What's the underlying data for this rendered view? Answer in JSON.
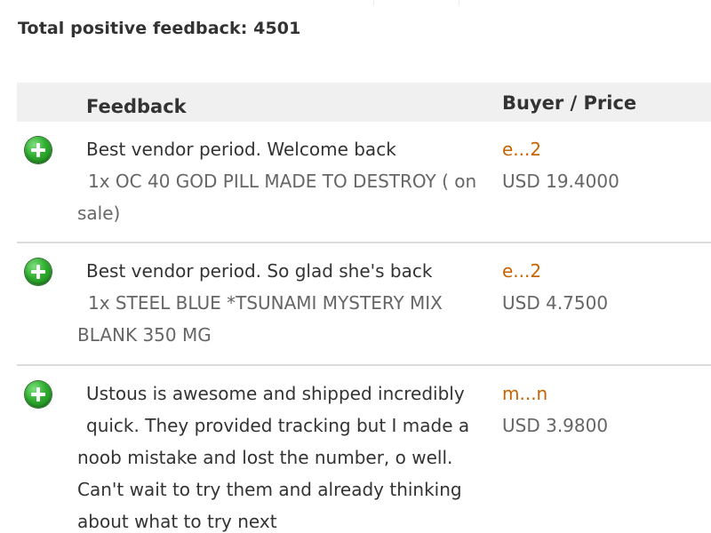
{
  "summary": {
    "label": "Total positive feedback:",
    "count": "4501"
  },
  "table": {
    "headers": {
      "feedback": "Feedback",
      "buyer_price": "Buyer / Price"
    },
    "rows": [
      {
        "rating_icon": "positive-plus-icon",
        "comment": "Best vendor period. Welcome back",
        "item_line1": "1x OC 40 GOD PILL MADE TO DESTROY ( on",
        "item_line2": "sale)",
        "buyer": "e...2",
        "price": "USD 19.4000"
      },
      {
        "rating_icon": "positive-plus-icon",
        "comment": "Best vendor period. So glad she's back",
        "item_line1": "1x STEEL BLUE *TSUNAMI MYSTERY MIX",
        "item_line2": "BLANK 350 MG",
        "buyer": "e...2",
        "price": "USD 4.7500"
      },
      {
        "rating_icon": "positive-plus-icon",
        "comment_line1": "Ustous is awesome and shipped incredibly",
        "comment_line2": "quick. They provided tracking but I made a",
        "comment_line3": "noob mistake and lost the number, o well.",
        "comment_line4": "Can't wait to try them and already thinking",
        "comment_line5": "about what to try next",
        "buyer": "m...n",
        "price": "USD 3.9800"
      }
    ]
  },
  "colors": {
    "buyer_link": "#c86400",
    "header_bg": "#f0f0f0",
    "positive_icon": "#2fae2f"
  }
}
